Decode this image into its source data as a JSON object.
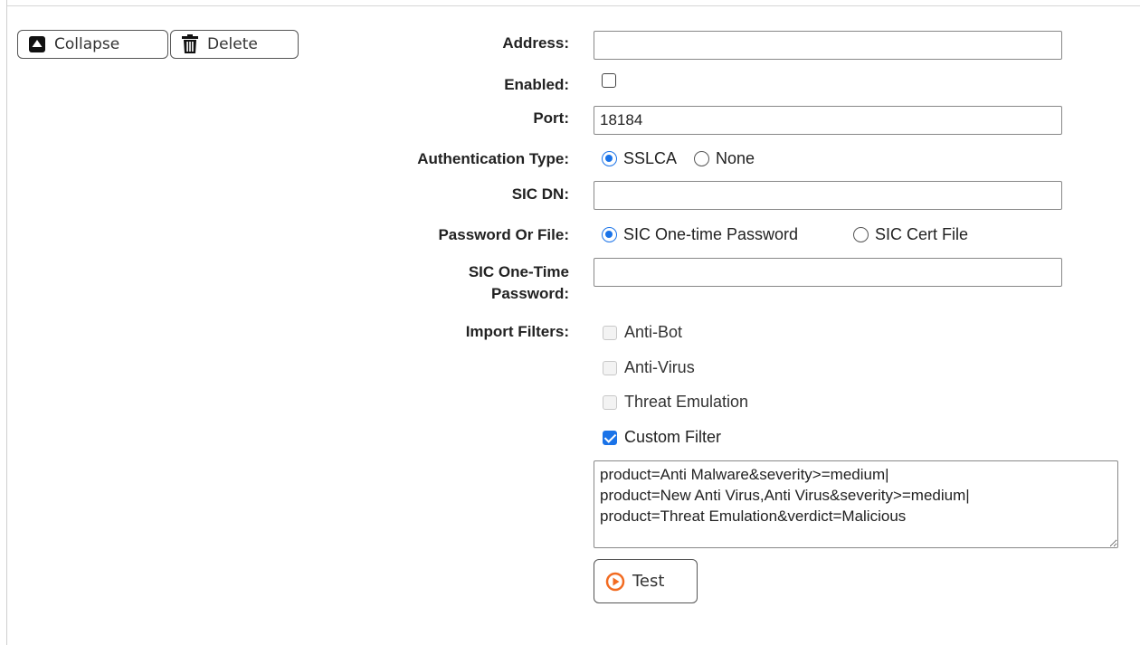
{
  "toolbar": {
    "collapse_label": "Collapse",
    "delete_label": "Delete",
    "collapse_icon": "collapse-up-icon",
    "delete_icon": "trash-icon"
  },
  "form": {
    "address": {
      "label": "Address:",
      "value": ""
    },
    "enabled": {
      "label": "Enabled:",
      "checked": false
    },
    "port": {
      "label": "Port:",
      "value": "18184"
    },
    "auth_type": {
      "label": "Authentication Type:",
      "options": [
        "SSLCA",
        "None"
      ],
      "selected": "SSLCA"
    },
    "sic_dn": {
      "label": "SIC DN:",
      "value": ""
    },
    "password_or_file": {
      "label": "Password Or File:",
      "options": [
        "SIC One-time Password",
        "SIC Cert File"
      ],
      "selected": "SIC One-time Password"
    },
    "sic_otp": {
      "label_line1": "SIC One-Time",
      "label_line2": "Password:",
      "value": ""
    },
    "import_filters": {
      "label": "Import Filters:",
      "options": [
        {
          "label": "Anti-Bot",
          "checked": false,
          "disabled": true
        },
        {
          "label": "Anti-Virus",
          "checked": false,
          "disabled": true
        },
        {
          "label": "Threat Emulation",
          "checked": false,
          "disabled": true
        },
        {
          "label": "Custom Filter",
          "checked": true,
          "disabled": false
        }
      ],
      "custom_filter_value": "product=Anti Malware&severity>=medium|\nproduct=New Anti Virus,Anti Virus&severity>=medium|\nproduct=Threat Emulation&verdict=Malicious"
    }
  },
  "test_button": {
    "label": "Test",
    "icon": "play-circle-icon",
    "icon_color": "#f26b21"
  },
  "colors": {
    "accent": "#1a73e8"
  }
}
